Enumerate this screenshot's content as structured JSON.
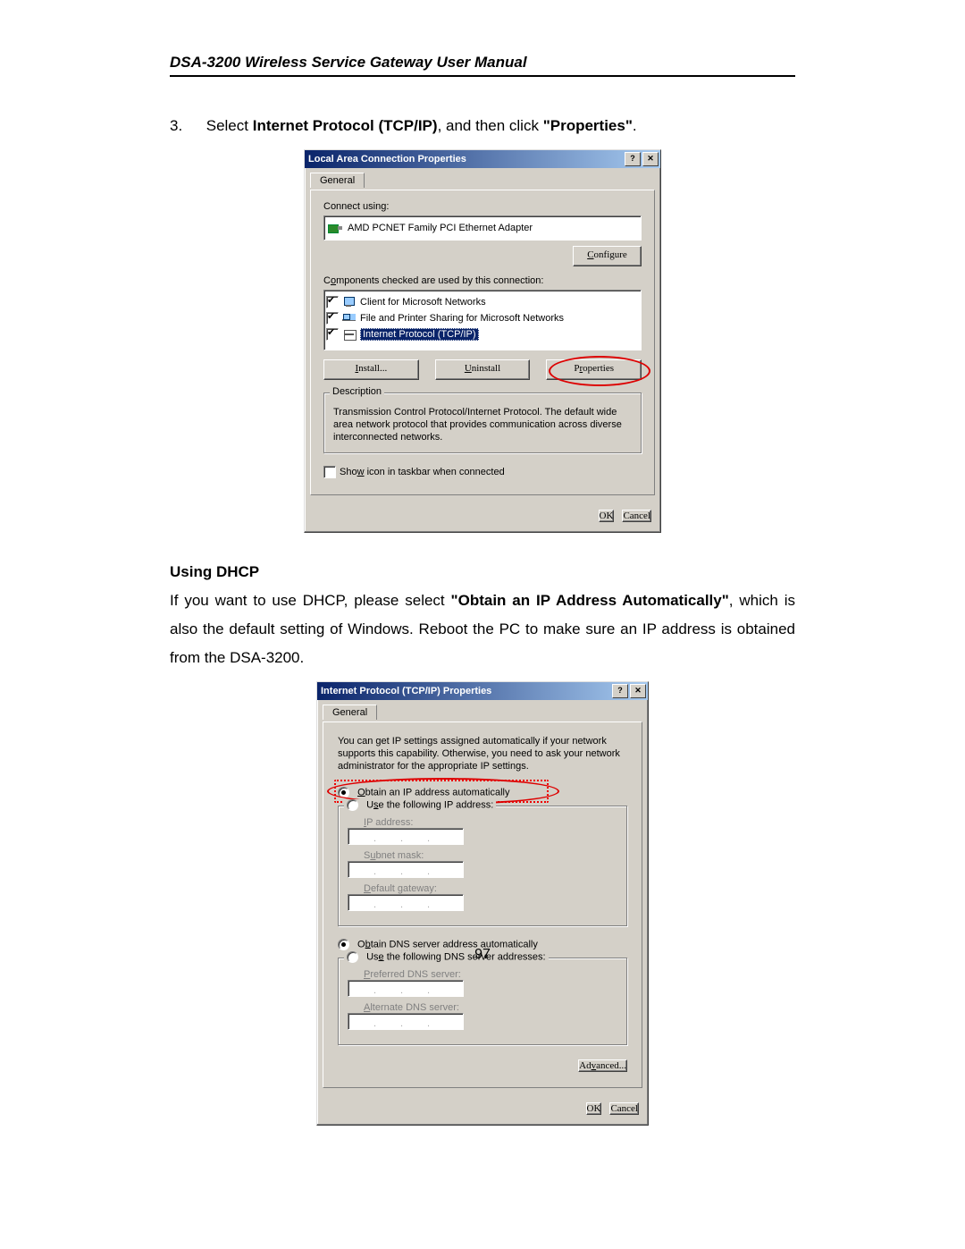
{
  "header": "DSA-3200 Wireless Service Gateway User Manual",
  "step": {
    "num": "3.",
    "pre": "Select ",
    "bold1": "Internet Protocol (TCP/IP)",
    "mid": ", and then click ",
    "bold2": "\"Properties\"",
    "post": "."
  },
  "dialog1": {
    "title": "Local Area Connection Properties",
    "help": "?",
    "close": "✕",
    "tab": "General",
    "connect_using": "Connect using:",
    "adapter": "AMD PCNET Family PCI Ethernet Adapter",
    "configure": "Configure",
    "components_label": "Components checked are used by this connection:",
    "cmp": [
      "Client for Microsoft Networks",
      "File and Printer Sharing for Microsoft Networks",
      "Internet Protocol (TCP/IP)"
    ],
    "install": "Install...",
    "uninstall": "Uninstall",
    "properties": "Properties",
    "desc_legend": "Description",
    "desc": "Transmission Control Protocol/Internet Protocol. The default wide area network protocol that provides communication across diverse interconnected networks.",
    "show_icon": "Show icon in taskbar when connected",
    "ok": "OK",
    "cancel": "Cancel"
  },
  "dhcp_heading": "Using DHCP",
  "dhcp_body": {
    "p1a": "If you want to use DHCP, please select ",
    "p1b": "\"Obtain an IP Address Automatically\"",
    "p1c": ", which is also the default setting of Windows.  Reboot the PC to make sure an IP address is obtained from the DSA-3200."
  },
  "dialog2": {
    "title": "Internet Protocol (TCP/IP) Properties",
    "help": "?",
    "close": "✕",
    "tab": "General",
    "intro": "You can get IP settings assigned automatically if your network supports this capability. Otherwise, you need to ask your network administrator for the appropriate IP settings.",
    "r1": "Obtain an IP address automatically",
    "r2": "Use the following IP address:",
    "ip": "IP address:",
    "subnet": "Subnet mask:",
    "gateway": "Default gateway:",
    "r3": "Obtain DNS server address automatically",
    "r4": "Use the following DNS server addresses:",
    "pdns": "Preferred DNS server:",
    "adns": "Alternate DNS server:",
    "advanced": "Advanced...",
    "ok": "OK",
    "cancel": "Cancel"
  },
  "page_number": "97"
}
